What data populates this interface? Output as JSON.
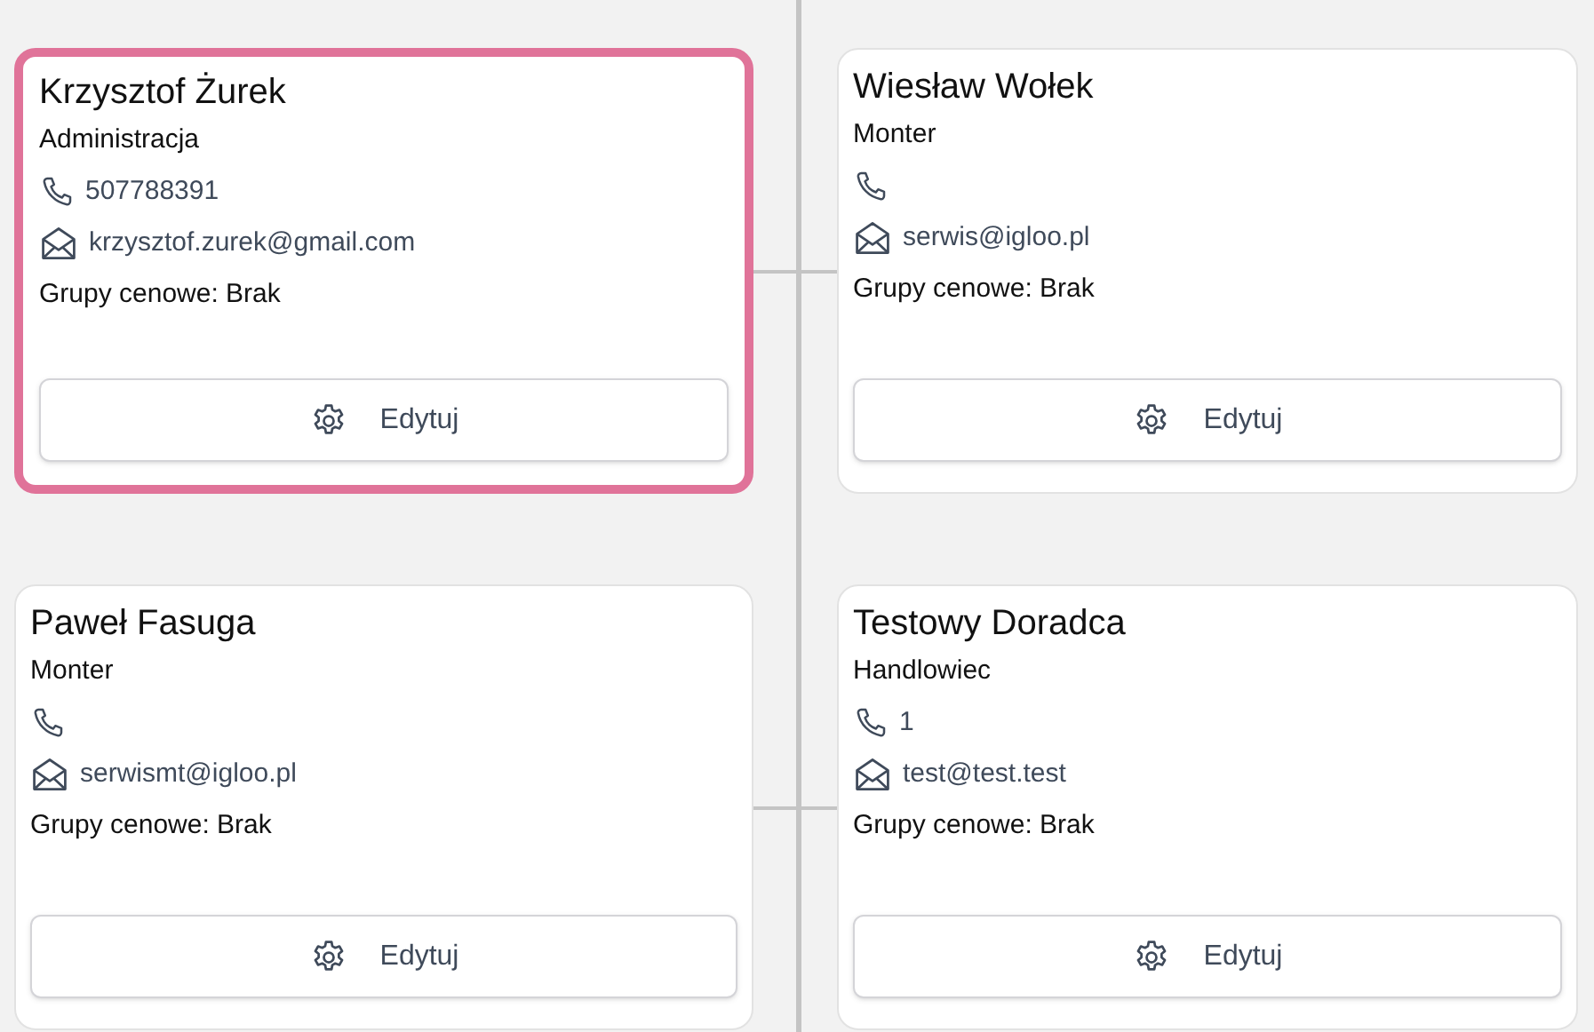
{
  "cards": [
    {
      "name": "Krzysztof Żurek",
      "role": "Administracja",
      "phone": "507788391",
      "email": "krzysztof.zurek@gmail.com",
      "groups": "Grupy cenowe: Brak",
      "button": "Edytuj",
      "selected": true
    },
    {
      "name": "Wiesław Wołek",
      "role": "Monter",
      "email": "serwis@igloo.pl",
      "groups": "Grupy cenowe: Brak",
      "button": "Edytuj",
      "selected": false
    },
    {
      "name": "Paweł Fasuga",
      "role": "Monter",
      "email": "serwismt@igloo.pl",
      "groups": "Grupy cenowe: Brak",
      "button": "Edytuj",
      "selected": false
    },
    {
      "name": "Testowy Doradca",
      "role": "Handlowiec",
      "phone": "1",
      "email": "test@test.test",
      "groups": "Grupy cenowe: Brak",
      "button": "Edytuj",
      "selected": false
    }
  ]
}
